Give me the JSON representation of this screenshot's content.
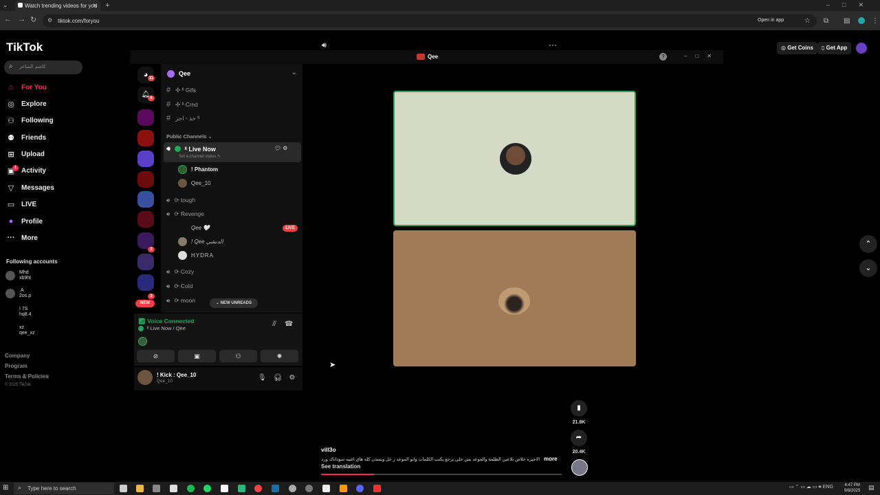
{
  "browser": {
    "tab_title": "Watch trending videos for you",
    "url": "tiktok.com/foryou",
    "open_in_app": "Open in app"
  },
  "tiktok": {
    "logo": "TikTok",
    "search_placeholder": "كاشم الساعر",
    "nav": [
      {
        "label": "For You",
        "icon": "home-icon"
      },
      {
        "label": "Explore",
        "icon": "compass-icon"
      },
      {
        "label": "Following",
        "icon": "following-icon"
      },
      {
        "label": "Friends",
        "icon": "friends-icon"
      },
      {
        "label": "Upload",
        "icon": "upload-icon"
      },
      {
        "label": "Activity",
        "icon": "bell-icon",
        "badge": "1"
      },
      {
        "label": "Messages",
        "icon": "messages-icon"
      },
      {
        "label": "LIVE",
        "icon": "live-icon"
      },
      {
        "label": "Profile",
        "icon": "profile-icon"
      },
      {
        "label": "More",
        "icon": "more-icon"
      }
    ],
    "following_header": "Following accounts",
    "following": [
      {
        "name": "Mhd",
        "handle": "xb9ht"
      },
      {
        "name": ".A",
        "handle": "2os.p"
      },
      {
        "name": "I 7S",
        "handle": "hq8.4"
      },
      {
        "name": "xz",
        "handle": "qee_xz"
      }
    ],
    "footer": [
      "Company",
      "Program",
      "Terms & Policies"
    ],
    "copyright": "© 2025 TikTok",
    "get_coins": "Get Coins",
    "get_app": "Get App",
    "video": {
      "author": "vill3o",
      "caption": "الاخيره خلاص بلاعبن الظلمة والموعد بس خلي يرجع يكتب الكلمات وابو الموعد ز عل ويسدن كله هاي اغنيه سوداناك وردشاه ...",
      "more": "more",
      "see_translation": "See translation",
      "saves": "21.8K",
      "shares": "20.4K",
      "progress": 0.22
    }
  },
  "discord": {
    "window_title": "Qee",
    "help": "?",
    "server_name": "Qee",
    "channels": [
      {
        "name": "✣ ᴵᴵ Gifs"
      },
      {
        "name": "✣ ᴵᴵ Cmd"
      },
      {
        "name": "خذ ◦ اجر ᴵᴵ"
      }
    ],
    "category": "Public Channels",
    "live_channel": {
      "name": "ᴵᴵ Live Now",
      "status": "Set a channel status"
    },
    "live_members": [
      {
        "name": "! Phantom"
      },
      {
        "name": "Qee_10"
      }
    ],
    "voice_channels": [
      {
        "name": "⟳ tough"
      },
      {
        "name": "⟳ Revenge"
      }
    ],
    "revenge_members": [
      {
        "name": "Qee 🤍"
      },
      {
        "name": "! Qee الدنشي"
      },
      {
        "name": "HYDRA"
      }
    ],
    "live_badge": "LIVE",
    "voice_channels_more": [
      {
        "name": "⟳ Cozy"
      },
      {
        "name": "⟳ Cold"
      },
      {
        "name": "⟳ moon"
      }
    ],
    "new_unreads": "NEW UNREADS",
    "new_badge": "NEW",
    "server_badges": [
      "11",
      "6",
      "2",
      "3"
    ],
    "voice_connected": "Voice Connected",
    "voice_sub": "ᴵᴵ Live Now / Qee",
    "user_name": "! Kick : Qee_10",
    "user_sub": "Qee_10"
  },
  "taskbar": {
    "search": "Type here to search",
    "lang": "ENG",
    "time": "4:47 PM",
    "date": "9/8/2025"
  }
}
